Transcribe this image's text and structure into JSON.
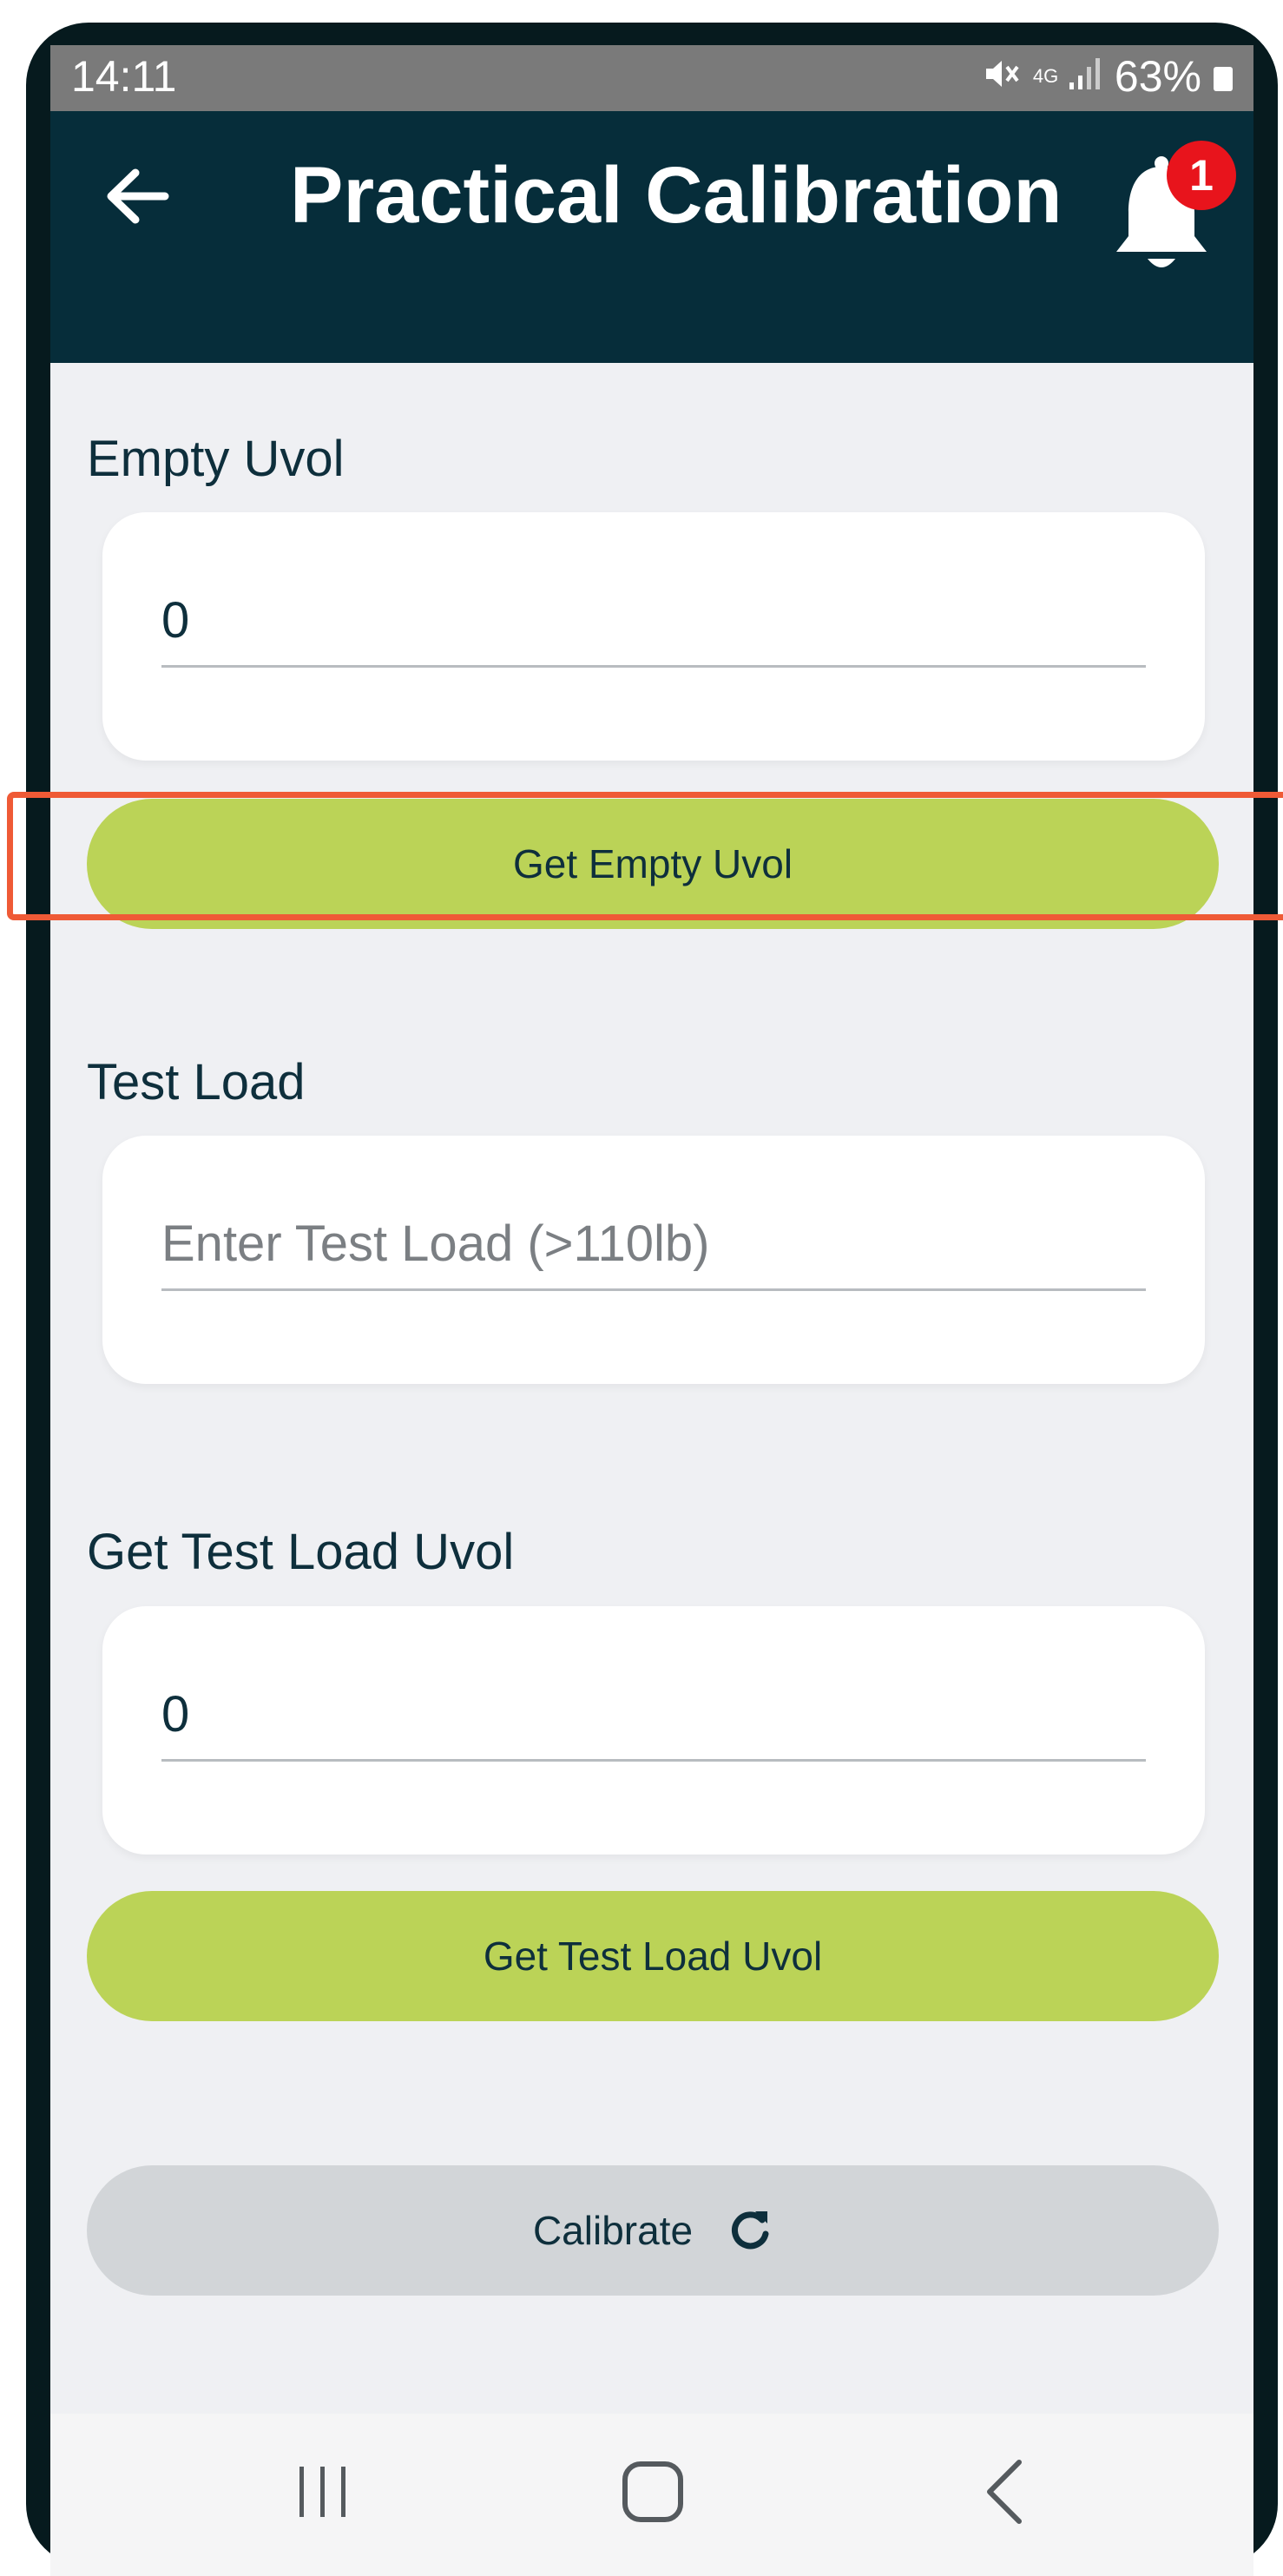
{
  "status_bar": {
    "time": "14:11",
    "network": "4G",
    "battery": "63%",
    "icons": [
      "mute-icon",
      "signal-icon",
      "battery-icon"
    ]
  },
  "app_bar": {
    "title": "Practical Calibration",
    "notification_count": "1",
    "background_color": "#062d3a"
  },
  "empty_uvol": {
    "label": "Empty Uvol",
    "value": "0",
    "button_label": "Get Empty Uvol"
  },
  "test_load": {
    "label": "Test Load",
    "placeholder": "Enter Test Load (>110lb)"
  },
  "test_load_uvol": {
    "label": "Get Test Load Uvol",
    "value": "0",
    "button_label": "Get Test Load Uvol"
  },
  "calibrate": {
    "button_label": "Calibrate"
  },
  "colors": {
    "accent_green": "#bbd357",
    "highlight": "#ef5a36",
    "badge_red": "#e8141c"
  },
  "nav_bar": {
    "icons": [
      "recent-apps-icon",
      "home-icon",
      "back-nav-icon"
    ]
  }
}
